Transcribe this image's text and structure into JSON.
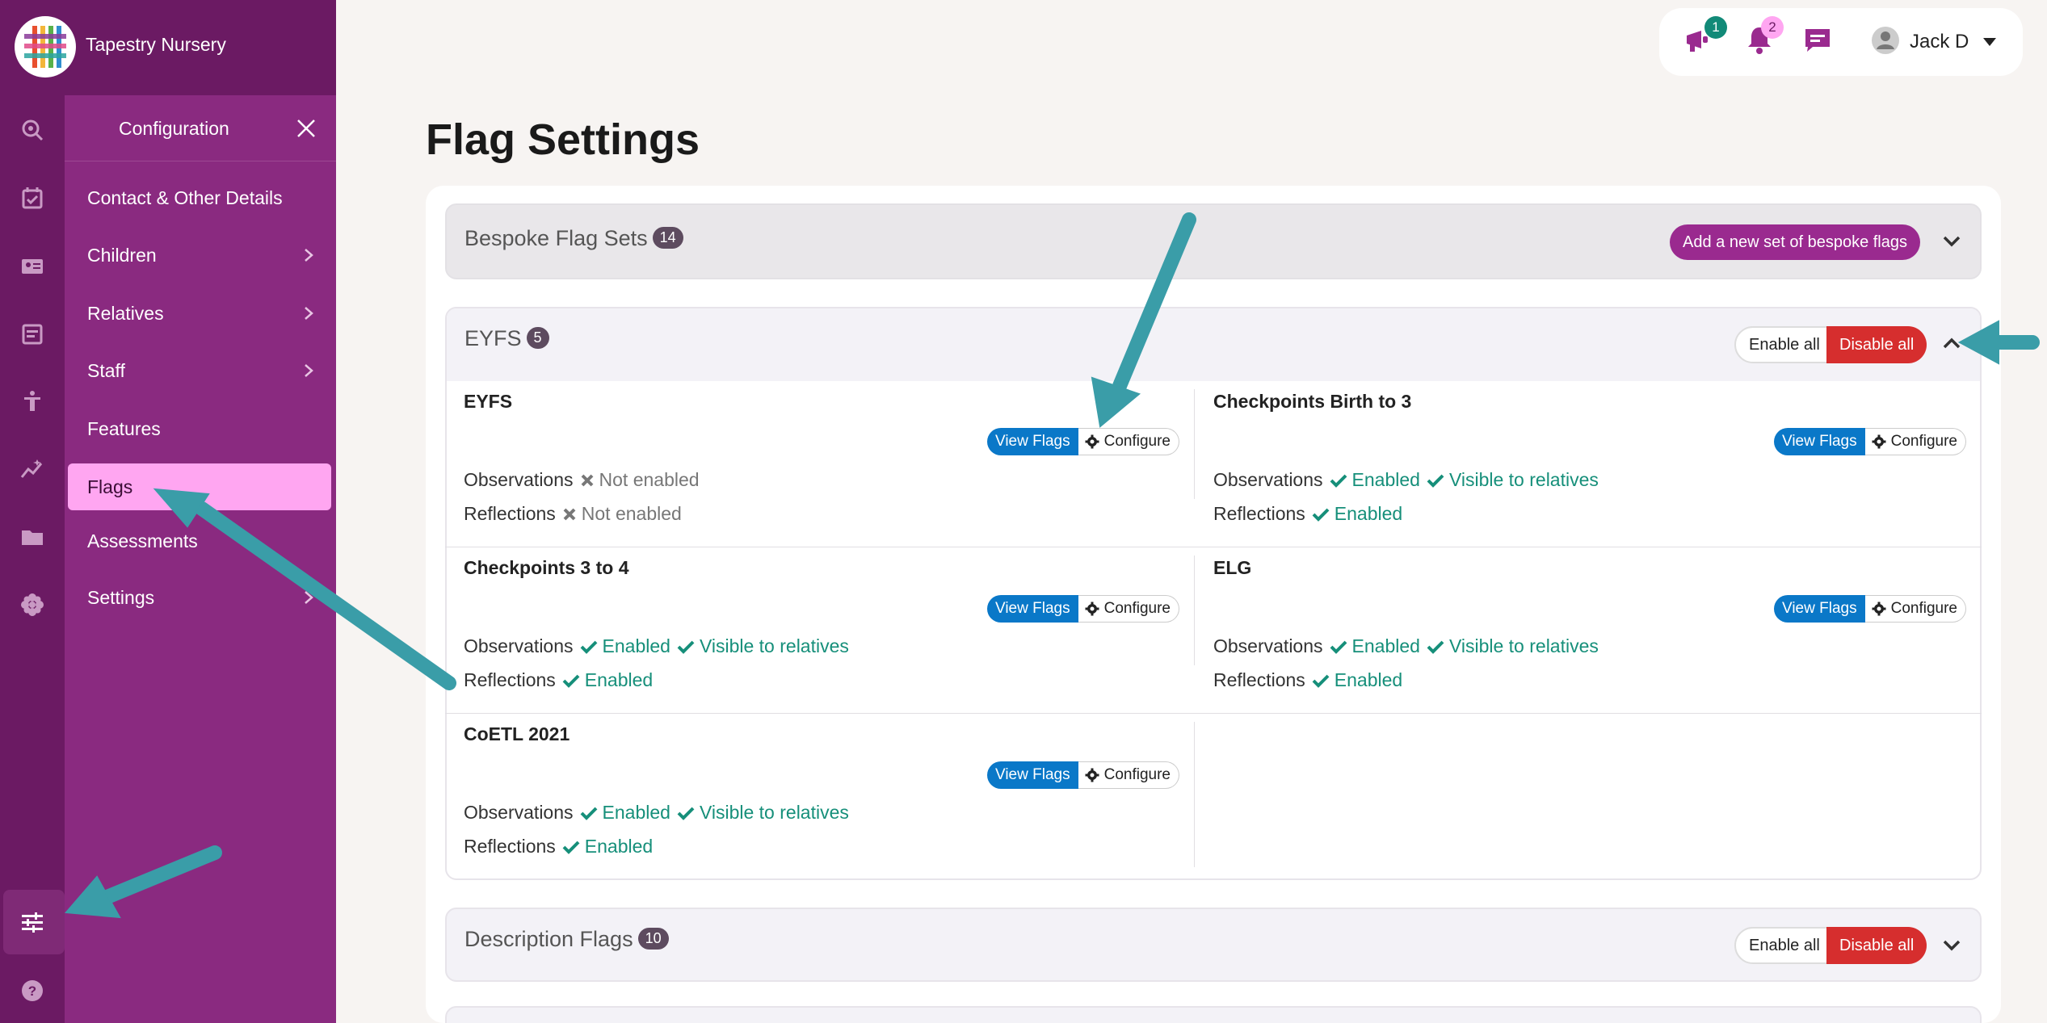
{
  "brand": {
    "name": "Tapestry Nursery"
  },
  "config_panel": {
    "title": "Configuration",
    "items": [
      {
        "label": "Contact & Other Details",
        "has_children": false
      },
      {
        "label": "Children",
        "has_children": true
      },
      {
        "label": "Relatives",
        "has_children": true
      },
      {
        "label": "Staff",
        "has_children": true
      },
      {
        "label": "Features",
        "has_children": false
      },
      {
        "label": "Flags",
        "has_children": false,
        "active": true
      },
      {
        "label": "Assessments",
        "has_children": false
      },
      {
        "label": "Settings",
        "has_children": true
      }
    ]
  },
  "topbar": {
    "announcements_count": "1",
    "notifications_count": "2",
    "user_name": "Jack D"
  },
  "page": {
    "title": "Flag Settings"
  },
  "bespoke": {
    "title": "Bespoke Flag Sets",
    "count": "14",
    "add_label": "Add a new set of bespoke flags"
  },
  "eyfs": {
    "title": "EYFS",
    "count": "5",
    "enable_all": "Enable all",
    "disable_all": "Disable all",
    "view_flags": "View Flags",
    "configure": "Configure",
    "observations_label": "Observations",
    "reflections_label": "Reflections",
    "not_enabled": "Not enabled",
    "enabled": "Enabled",
    "visible": "Visible to relatives",
    "sets": [
      {
        "name": "EYFS",
        "observations": "Not enabled",
        "reflections": "Not enabled"
      },
      {
        "name": "Checkpoints Birth to 3",
        "observations": "Enabled",
        "observations_visible": "Visible to relatives",
        "reflections": "Enabled"
      },
      {
        "name": "Checkpoints 3 to 4",
        "observations": "Enabled",
        "observations_visible": "Visible to relatives",
        "reflections": "Enabled"
      },
      {
        "name": "ELG",
        "observations": "Enabled",
        "observations_visible": "Visible to relatives",
        "reflections": "Enabled"
      },
      {
        "name": "CoETL 2021",
        "observations": "Enabled",
        "observations_visible": "Visible to relatives",
        "reflections": "Enabled"
      }
    ]
  },
  "description": {
    "title": "Description Flags",
    "count": "10",
    "enable_all": "Enable all",
    "disable_all": "Disable all"
  },
  "colors": {
    "brand_purple": "#6b1a63",
    "panel_purple": "#8a2a80",
    "active_pink": "#ffa6f1",
    "accent_blue": "#0a78c8",
    "danger_red": "#d62e2e",
    "success_teal": "#168f7a",
    "arrow_teal": "#3a9da8"
  }
}
